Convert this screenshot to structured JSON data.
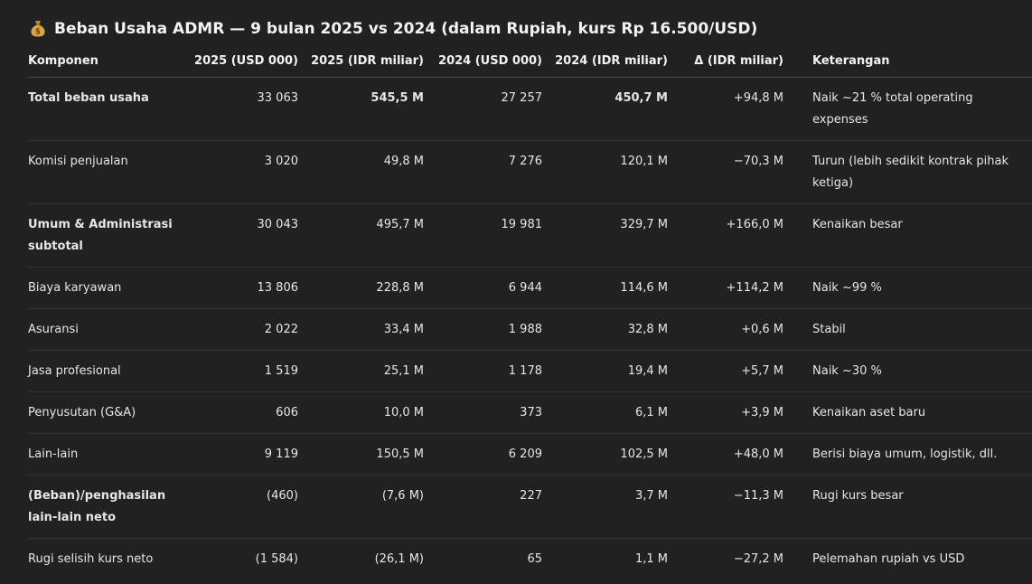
{
  "title": "Beban Usaha ADMR — 9 bulan 2025 vs 2024 (dalam Rupiah, kurs Rp 16.500/USD)",
  "title_icon": "money-bag-icon",
  "colors": {
    "background": "#212121",
    "text": "#ececec",
    "border": "#333333"
  },
  "table": {
    "headers": [
      "Komponen",
      "2025 (USD 000)",
      "2025 (IDR miliar)",
      "2024 (USD 000)",
      "2024 (IDR miliar)",
      "Δ (IDR miliar)",
      "Keterangan"
    ],
    "rows": [
      {
        "label": "Total beban usaha",
        "bold_label": true,
        "usd2025": "33 063",
        "idr2025": "545,5 M",
        "bold_idr": true,
        "usd2024": "27 257",
        "idr2024": "450,7 M",
        "delta": "+94,8 M",
        "note": "Naik ~21 % total operating expenses"
      },
      {
        "label": "Komisi penjualan",
        "bold_label": false,
        "usd2025": "3 020",
        "idr2025": "49,8 M",
        "bold_idr": false,
        "usd2024": "7 276",
        "idr2024": "120,1 M",
        "delta": "−70,3 M",
        "note": "Turun (lebih sedikit kontrak pihak ketiga)"
      },
      {
        "label": "Umum & Administrasi subtotal",
        "bold_label": true,
        "usd2025": "30 043",
        "idr2025": "495,7 M",
        "bold_idr": false,
        "usd2024": "19 981",
        "idr2024": "329,7 M",
        "delta": "+166,0 M",
        "note": "Kenaikan besar"
      },
      {
        "label": "Biaya karyawan",
        "bold_label": false,
        "usd2025": "13 806",
        "idr2025": "228,8 M",
        "bold_idr": false,
        "usd2024": "6 944",
        "idr2024": "114,6 M",
        "delta": "+114,2 M",
        "note": "Naik ~99 %"
      },
      {
        "label": "Asuransi",
        "bold_label": false,
        "usd2025": "2 022",
        "idr2025": "33,4 M",
        "bold_idr": false,
        "usd2024": "1 988",
        "idr2024": "32,8 M",
        "delta": "+0,6 M",
        "note": "Stabil"
      },
      {
        "label": "Jasa profesional",
        "bold_label": false,
        "usd2025": "1 519",
        "idr2025": "25,1 M",
        "bold_idr": false,
        "usd2024": "1 178",
        "idr2024": "19,4 M",
        "delta": "+5,7 M",
        "note": "Naik ~30 %"
      },
      {
        "label": "Penyusutan (G&A)",
        "bold_label": false,
        "usd2025": "606",
        "idr2025": "10,0 M",
        "bold_idr": false,
        "usd2024": "373",
        "idr2024": "6,1 M",
        "delta": "+3,9 M",
        "note": "Kenaikan aset baru"
      },
      {
        "label": "Lain-lain",
        "bold_label": false,
        "usd2025": "9 119",
        "idr2025": "150,5 M",
        "bold_idr": false,
        "usd2024": "6 209",
        "idr2024": "102,5 M",
        "delta": "+48,0 M",
        "note": "Berisi biaya umum, logistik, dll."
      },
      {
        "label": "(Beban)/penghasilan lain-lain neto",
        "bold_label": true,
        "usd2025": "(460)",
        "idr2025": "(7,6 M)",
        "bold_idr": false,
        "usd2024": "227",
        "idr2024": "3,7 M",
        "delta": "−11,3 M",
        "note": "Rugi kurs besar"
      },
      {
        "label": "Rugi selisih kurs neto",
        "bold_label": false,
        "usd2025": "(1 584)",
        "idr2025": "(26,1 M)",
        "bold_idr": false,
        "usd2024": "65",
        "idr2024": "1,1 M",
        "delta": "−27,2 M",
        "note": "Pelemahan rupiah vs USD"
      }
    ]
  }
}
